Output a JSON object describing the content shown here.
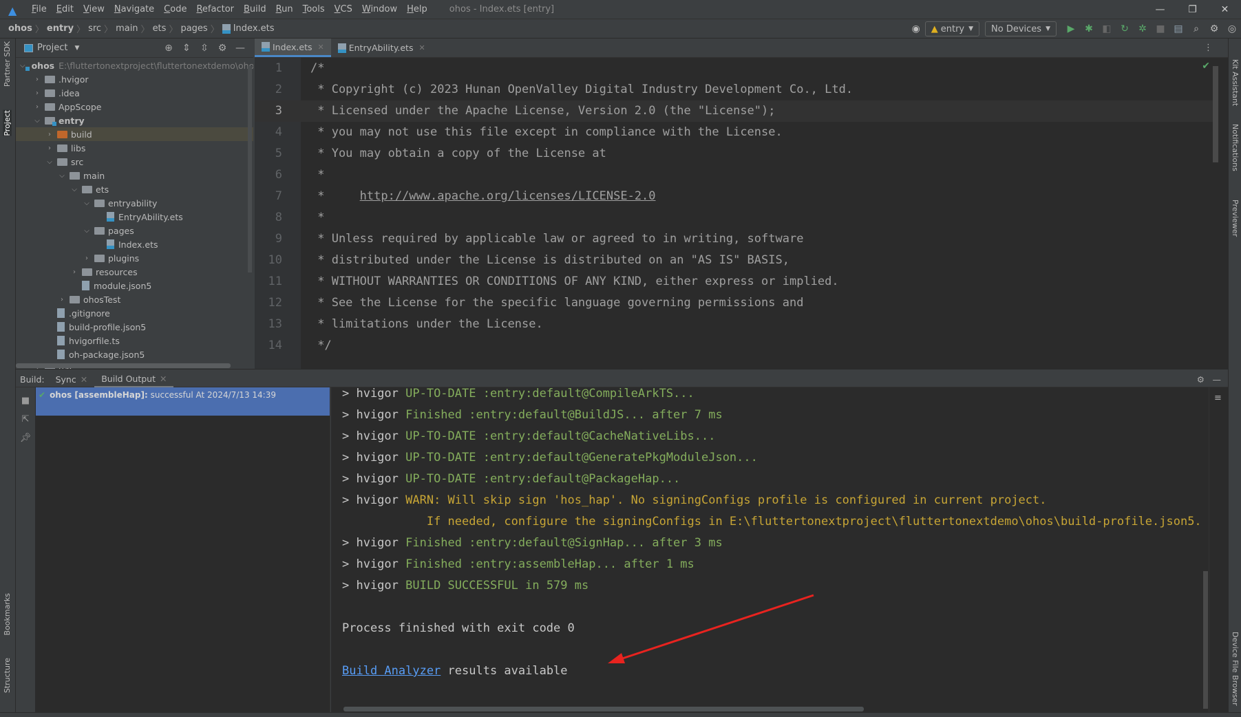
{
  "window": {
    "title": "ohos - Index.ets [entry]",
    "menu": [
      "File",
      "Edit",
      "View",
      "Navigate",
      "Code",
      "Refactor",
      "Build",
      "Run",
      "Tools",
      "VCS",
      "Window",
      "Help"
    ]
  },
  "breadcrumb": [
    "ohos",
    "entry",
    "src",
    "main",
    "ets",
    "pages",
    "Index.ets"
  ],
  "toolbar": {
    "run_config": "entry",
    "device": "No Devices"
  },
  "left_strip": {
    "partner_sdk": "Partner SDK",
    "project": "Project",
    "bookmarks": "Bookmarks",
    "structure": "Structure"
  },
  "right_strip": {
    "kit_assistant": "Kit Assistant",
    "notifications": "Notifications",
    "previewer": "Previewer",
    "device_file_browser": "Device File Browser"
  },
  "project": {
    "title": "Project",
    "tree": [
      {
        "label": "ohos",
        "depth": 0,
        "type": "module",
        "open": true,
        "bold": true,
        "path": "E:\\fluttertonextproject\\fluttertonextdemo\\ohos"
      },
      {
        "label": ".hvigor",
        "depth": 1,
        "type": "folder",
        "open": false
      },
      {
        "label": ".idea",
        "depth": 1,
        "type": "folder",
        "open": false
      },
      {
        "label": "AppScope",
        "depth": 1,
        "type": "folder",
        "open": false
      },
      {
        "label": "entry",
        "depth": 1,
        "type": "module",
        "open": true,
        "bold": true
      },
      {
        "label": "build",
        "depth": 2,
        "type": "orange",
        "open": false,
        "selected": true
      },
      {
        "label": "libs",
        "depth": 2,
        "type": "folder",
        "open": false
      },
      {
        "label": "src",
        "depth": 2,
        "type": "folder",
        "open": true
      },
      {
        "label": "main",
        "depth": 3,
        "type": "folder",
        "open": true
      },
      {
        "label": "ets",
        "depth": 4,
        "type": "folder",
        "open": true
      },
      {
        "label": "entryability",
        "depth": 5,
        "type": "folder",
        "open": true
      },
      {
        "label": "EntryAbility.ets",
        "depth": 6,
        "type": "file"
      },
      {
        "label": "pages",
        "depth": 5,
        "type": "folder",
        "open": true
      },
      {
        "label": "Index.ets",
        "depth": 6,
        "type": "file"
      },
      {
        "label": "plugins",
        "depth": 5,
        "type": "folder",
        "open": false
      },
      {
        "label": "resources",
        "depth": 4,
        "type": "folder",
        "open": false
      },
      {
        "label": "module.json5",
        "depth": 4,
        "type": "json"
      },
      {
        "label": "ohosTest",
        "depth": 3,
        "type": "folder",
        "open": false
      },
      {
        "label": ".gitignore",
        "depth": 2,
        "type": "json"
      },
      {
        "label": "build-profile.json5",
        "depth": 2,
        "type": "json"
      },
      {
        "label": "hvigorfile.ts",
        "depth": 2,
        "type": "json"
      },
      {
        "label": "oh-package.json5",
        "depth": 2,
        "type": "json"
      },
      {
        "label": "har",
        "depth": 1,
        "type": "folder",
        "open": false
      }
    ]
  },
  "editor": {
    "tabs": [
      {
        "label": "Index.ets",
        "active": true
      },
      {
        "label": "EntryAbility.ets",
        "active": false
      }
    ],
    "current_line": 3,
    "lines": [
      {
        "n": "1",
        "text": "/*"
      },
      {
        "n": "2",
        "text": " * Copyright (c) 2023 Hunan OpenValley Digital Industry Development Co., Ltd."
      },
      {
        "n": "3",
        "text": " * Licensed under the Apache License, Version 2.0 (the \"License\");"
      },
      {
        "n": "4",
        "text": " * you may not use this file except in compliance with the License."
      },
      {
        "n": "5",
        "text": " * You may obtain a copy of the License at"
      },
      {
        "n": "6",
        "text": " *"
      },
      {
        "n": "7",
        "text": " *     ",
        "link": "http://www.apache.org/licenses/LICENSE-2.0"
      },
      {
        "n": "8",
        "text": " *"
      },
      {
        "n": "9",
        "text": " * Unless required by applicable law or agreed to in writing, software"
      },
      {
        "n": "10",
        "text": " * distributed under the License is distributed on an \"AS IS\" BASIS,"
      },
      {
        "n": "11",
        "text": " * WITHOUT WARRANTIES OR CONDITIONS OF ANY KIND, either express or implied."
      },
      {
        "n": "12",
        "text": " * See the License for the specific language governing permissions and"
      },
      {
        "n": "13",
        "text": " * limitations under the License."
      },
      {
        "n": "14",
        "text": " */"
      }
    ]
  },
  "build": {
    "label": "Build:",
    "tabs": [
      "Sync",
      "Build Output"
    ],
    "item": {
      "title": "ohos [assembleHap]:",
      "status": "successful At 2024/7/13 14:39"
    },
    "console": [
      {
        "prefix": "> hvigor ",
        "text": "UP-TO-DATE :entry:default@CompileArkTS...",
        "kind": "g"
      },
      {
        "prefix": "> hvigor ",
        "text": "Finished :entry:default@BuildJS... after 7 ms",
        "kind": "g"
      },
      {
        "prefix": "> hvigor ",
        "text": "UP-TO-DATE :entry:default@CacheNativeLibs...",
        "kind": "g"
      },
      {
        "prefix": "> hvigor ",
        "text": "UP-TO-DATE :entry:default@GeneratePkgModuleJson...",
        "kind": "g"
      },
      {
        "prefix": "> hvigor ",
        "text": "UP-TO-DATE :entry:default@PackageHap...",
        "kind": "g"
      },
      {
        "prefix": "> hvigor ",
        "text": "WARN: Will skip sign 'hos_hap'. No signingConfigs profile is configured in current project.",
        "kind": "w"
      },
      {
        "prefix": "            ",
        "text": "If needed, configure the signingConfigs in E:\\fluttertonextproject\\fluttertonextdemo\\ohos\\build-profile.json5.",
        "kind": "w"
      },
      {
        "prefix": "> hvigor ",
        "text": "Finished :entry:default@SignHap... after 3 ms",
        "kind": "g"
      },
      {
        "prefix": "> hvigor ",
        "text": "Finished :entry:assembleHap... after 1 ms",
        "kind": "g"
      },
      {
        "prefix": "> hvigor ",
        "text": "BUILD SUCCESSFUL in 579 ms",
        "kind": "g"
      },
      {
        "prefix": "",
        "text": "",
        "kind": ""
      },
      {
        "prefix": "Process finished with exit code 0",
        "text": "",
        "kind": ""
      },
      {
        "prefix": "",
        "text": "",
        "kind": ""
      },
      {
        "prefix": "",
        "link": "Build Analyzer",
        "text": " results available",
        "kind": ""
      }
    ]
  },
  "colors": {
    "annotation_arrow": "#e8231f",
    "accent": "#4b6eaf"
  }
}
